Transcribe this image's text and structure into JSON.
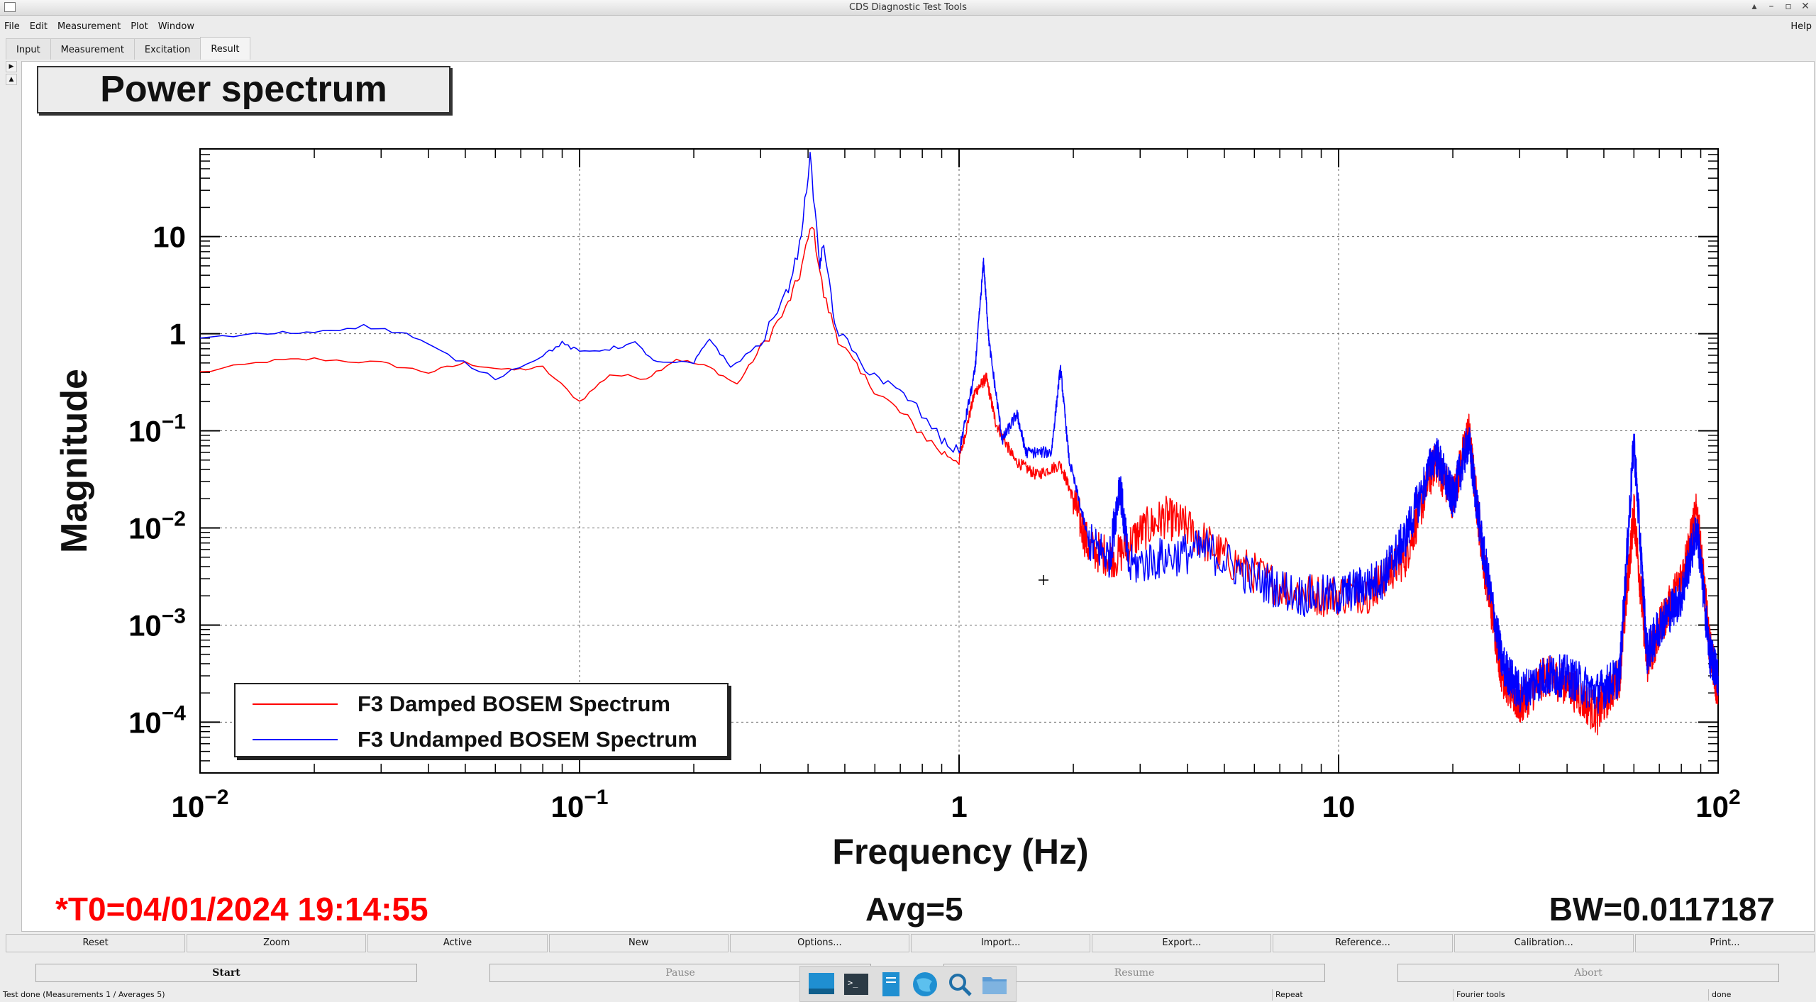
{
  "window": {
    "title": "CDS Diagnostic Test Tools"
  },
  "menu": {
    "items": [
      "File",
      "Edit",
      "Measurement",
      "Plot",
      "Window"
    ],
    "help": "Help"
  },
  "tabs": [
    "Input",
    "Measurement",
    "Excitation",
    "Result"
  ],
  "active_tab": "Result",
  "plot": {
    "title": "Power spectrum",
    "ylabel": "Magnitude",
    "xlabel": "Frequency (Hz)",
    "t0": "*T0=04/01/2024 19:14:55",
    "avg": "Avg=5",
    "bw": "BW=0.0117187"
  },
  "chart_data": {
    "type": "line",
    "title": "Power spectrum",
    "xlabel": "Frequency (Hz)",
    "ylabel": "Magnitude",
    "xscale": "log",
    "yscale": "log",
    "xlim": [
      0.01,
      100
    ],
    "ylim": [
      3e-05,
      80
    ],
    "grid": true,
    "legend_position": "bottom-left",
    "x_tick_labels": [
      "10^-2",
      "10^-1",
      "1",
      "10",
      "10^2"
    ],
    "y_tick_labels": [
      "10^-4",
      "10^-3",
      "10^-2",
      "10^-1",
      "1",
      "10"
    ],
    "series": [
      {
        "name": "F3 Damped BOSEM Spectrum",
        "color": "#ff0000",
        "points": [
          [
            0.01,
            0.4
          ],
          [
            0.015,
            0.52
          ],
          [
            0.02,
            0.55
          ],
          [
            0.03,
            0.5
          ],
          [
            0.04,
            0.4
          ],
          [
            0.05,
            0.5
          ],
          [
            0.065,
            0.42
          ],
          [
            0.08,
            0.45
          ],
          [
            0.1,
            0.2
          ],
          [
            0.12,
            0.38
          ],
          [
            0.15,
            0.35
          ],
          [
            0.18,
            0.55
          ],
          [
            0.22,
            0.45
          ],
          [
            0.26,
            0.3
          ],
          [
            0.3,
            0.7
          ],
          [
            0.35,
            1.8
          ],
          [
            0.38,
            4
          ],
          [
            0.41,
            14
          ],
          [
            0.44,
            2.5
          ],
          [
            0.48,
            0.9
          ],
          [
            0.55,
            0.38
          ],
          [
            0.65,
            0.2
          ],
          [
            0.75,
            0.12
          ],
          [
            0.9,
            0.06
          ],
          [
            1.0,
            0.05
          ],
          [
            1.1,
            0.25
          ],
          [
            1.18,
            0.35
          ],
          [
            1.25,
            0.12
          ],
          [
            1.4,
            0.05
          ],
          [
            1.6,
            0.035
          ],
          [
            1.85,
            0.045
          ],
          [
            2.0,
            0.02
          ],
          [
            2.2,
            0.006
          ],
          [
            2.6,
            0.005
          ],
          [
            3.0,
            0.009
          ],
          [
            3.5,
            0.013
          ],
          [
            4.0,
            0.01
          ],
          [
            5.0,
            0.005
          ],
          [
            7.0,
            0.0025
          ],
          [
            9.0,
            0.002
          ],
          [
            12.0,
            0.0022
          ],
          [
            15.0,
            0.005
          ],
          [
            18.0,
            0.05
          ],
          [
            20.0,
            0.02
          ],
          [
            22.0,
            0.1
          ],
          [
            24.0,
            0.005
          ],
          [
            27.0,
            0.0003
          ],
          [
            30.0,
            0.00015
          ],
          [
            35.0,
            0.0003
          ],
          [
            40.0,
            0.00025
          ],
          [
            48.0,
            0.00012
          ],
          [
            55.0,
            0.0003
          ],
          [
            60.0,
            0.015
          ],
          [
            65.0,
            0.0004
          ],
          [
            70.0,
            0.0009
          ],
          [
            80.0,
            0.003
          ],
          [
            88.0,
            0.015
          ],
          [
            95.0,
            0.0006
          ],
          [
            100.0,
            0.0002
          ]
        ]
      },
      {
        "name": "F3 Undamped BOSEM Spectrum",
        "color": "#0000ff",
        "points": [
          [
            0.01,
            0.9
          ],
          [
            0.015,
            1.0
          ],
          [
            0.02,
            1.05
          ],
          [
            0.027,
            1.2
          ],
          [
            0.035,
            1.0
          ],
          [
            0.045,
            0.6
          ],
          [
            0.06,
            0.35
          ],
          [
            0.08,
            0.6
          ],
          [
            0.09,
            0.8
          ],
          [
            0.1,
            0.65
          ],
          [
            0.12,
            0.7
          ],
          [
            0.14,
            0.8
          ],
          [
            0.16,
            0.5
          ],
          [
            0.2,
            0.5
          ],
          [
            0.22,
            0.9
          ],
          [
            0.25,
            0.45
          ],
          [
            0.3,
            0.8
          ],
          [
            0.35,
            2.5
          ],
          [
            0.38,
            8
          ],
          [
            0.405,
            65
          ],
          [
            0.43,
            5
          ],
          [
            0.44,
            9
          ],
          [
            0.47,
            1.2
          ],
          [
            0.55,
            0.5
          ],
          [
            0.65,
            0.3
          ],
          [
            0.75,
            0.2
          ],
          [
            0.9,
            0.08
          ],
          [
            1.0,
            0.06
          ],
          [
            1.1,
            0.4
          ],
          [
            1.16,
            5.5
          ],
          [
            1.2,
            0.8
          ],
          [
            1.3,
            0.08
          ],
          [
            1.42,
            0.15
          ],
          [
            1.5,
            0.06
          ],
          [
            1.75,
            0.06
          ],
          [
            1.85,
            0.45
          ],
          [
            1.95,
            0.05
          ],
          [
            2.2,
            0.007
          ],
          [
            2.5,
            0.005
          ],
          [
            2.65,
            0.03
          ],
          [
            2.8,
            0.004
          ],
          [
            3.5,
            0.005
          ],
          [
            4.5,
            0.006
          ],
          [
            6.0,
            0.003
          ],
          [
            8.0,
            0.002
          ],
          [
            10.0,
            0.002
          ],
          [
            13.0,
            0.003
          ],
          [
            15.0,
            0.008
          ],
          [
            18.0,
            0.06
          ],
          [
            20.0,
            0.02
          ],
          [
            22.0,
            0.08
          ],
          [
            24.0,
            0.006
          ],
          [
            27.0,
            0.0004
          ],
          [
            30.0,
            0.0002
          ],
          [
            35.0,
            0.0003
          ],
          [
            40.0,
            0.0003
          ],
          [
            48.0,
            0.0002
          ],
          [
            55.0,
            0.0003
          ],
          [
            60.0,
            0.08
          ],
          [
            65.0,
            0.0005
          ],
          [
            70.0,
            0.001
          ],
          [
            80.0,
            0.002
          ],
          [
            88.0,
            0.01
          ],
          [
            95.0,
            0.0005
          ],
          [
            100.0,
            0.0003
          ]
        ]
      }
    ]
  },
  "controls": [
    "Reset",
    "Zoom",
    "Active",
    "New",
    "Options...",
    "Import...",
    "Export...",
    "Reference...",
    "Calibration...",
    "Print..."
  ],
  "run_buttons": {
    "start": "Start",
    "pause": "Pause",
    "resume": "Resume",
    "abort": "Abort"
  },
  "status": {
    "message": "Test done (Measurements 1 / Averages 5)",
    "repeat": "Repeat",
    "tools": "Fourier tools",
    "state": "done"
  },
  "taskbar": [
    "desktop-icon",
    "terminal-icon",
    "text-editor-icon",
    "browser-icon",
    "search-icon",
    "folder-icon"
  ]
}
